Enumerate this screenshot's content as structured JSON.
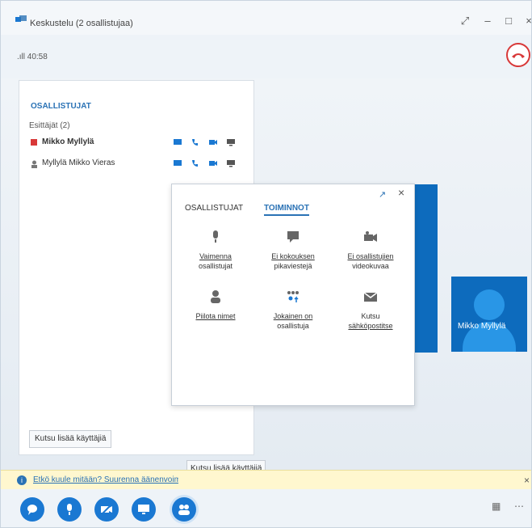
{
  "window": {
    "title": "Keskustelu (2 osallistujaa)",
    "status": "40:58"
  },
  "participants": {
    "heading": "OSALLISTUJAT",
    "group": "Esittäjät (2)",
    "people": [
      {
        "name": "Mikko Myllylä",
        "status_color": "#d83838"
      },
      {
        "name": "Myllylä Mikko   Vieras",
        "status_color": "#777777"
      }
    ],
    "invite_label": "Kutsu lisää käyttäjiä"
  },
  "video": {
    "small_label": "Mikko Myllylä"
  },
  "popup": {
    "tab_participants": "OSALLISTUJAT",
    "tab_actions": "TOIMINNOT",
    "actions": [
      {
        "label_1": "Vaimenna",
        "label_2": "osallistujat"
      },
      {
        "label_1": "Ei kokouksen",
        "label_2": "pikaviestejä"
      },
      {
        "label_1": "Ei osallistujien",
        "label_2": "videokuvaa"
      },
      {
        "label_1": "Piilota nimet",
        "label_2": ""
      },
      {
        "label_1": "Jokainen on",
        "label_2": "osallistuja"
      },
      {
        "label_1": "Kutsu",
        "label_2": "sähköpostitse"
      }
    ],
    "invite_label": "Kutsu lisää käyttäjiä"
  },
  "notice": {
    "text": "Etkö kuule mitään? Suurenna äänenvoimakkuutta"
  },
  "colors": {
    "accent": "#1a78d2",
    "hangup": "#d83838"
  }
}
